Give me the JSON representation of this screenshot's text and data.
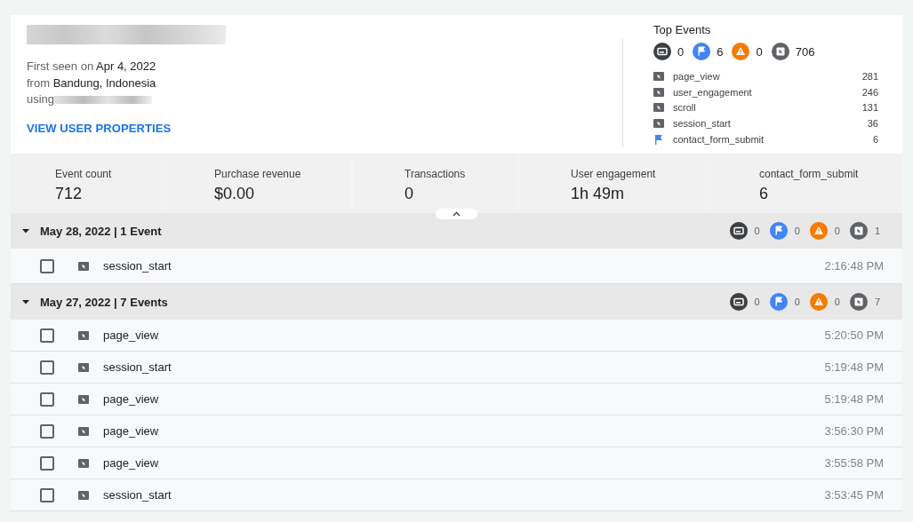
{
  "user": {
    "first_seen_label": "First seen on",
    "first_seen": "Apr 4, 2022",
    "from_label": "from",
    "location": "Bandung, Indonesia",
    "using_label": "using",
    "link": "VIEW USER PROPERTIES"
  },
  "top_events": {
    "title": "Top Events",
    "counts": [
      {
        "kind": "screen",
        "count": "0"
      },
      {
        "kind": "conversion",
        "count": "6"
      },
      {
        "kind": "error",
        "count": "0"
      },
      {
        "kind": "event",
        "count": "706"
      }
    ],
    "items": [
      {
        "kind": "event",
        "name": "page_view",
        "count": "281"
      },
      {
        "kind": "event",
        "name": "user_engagement",
        "count": "246"
      },
      {
        "kind": "event",
        "name": "scroll",
        "count": "131"
      },
      {
        "kind": "event",
        "name": "session_start",
        "count": "36"
      },
      {
        "kind": "conversion",
        "name": "contact_form_submit",
        "count": "6"
      }
    ]
  },
  "stats": [
    {
      "label": "Event count",
      "value": "712"
    },
    {
      "label": "Purchase revenue",
      "value": "$0.00"
    },
    {
      "label": "Transactions",
      "value": "0"
    },
    {
      "label": "User engagement",
      "value": "1h 49m"
    },
    {
      "label": "contact_form_submit",
      "value": "6"
    }
  ],
  "groups": [
    {
      "title": "May 28, 2022 | 1 Event",
      "expanded": true,
      "counts": [
        {
          "kind": "screen",
          "count": "0"
        },
        {
          "kind": "conversion",
          "count": "0"
        },
        {
          "kind": "error",
          "count": "0"
        },
        {
          "kind": "event",
          "count": "1"
        }
      ],
      "events": [
        {
          "kind": "event",
          "name": "session_start",
          "time": "2:16:48 PM",
          "checked": false
        }
      ]
    },
    {
      "title": "May 27, 2022 | 7 Events",
      "expanded": true,
      "counts": [
        {
          "kind": "screen",
          "count": "0"
        },
        {
          "kind": "conversion",
          "count": "0"
        },
        {
          "kind": "error",
          "count": "0"
        },
        {
          "kind": "event",
          "count": "7"
        }
      ],
      "events": [
        {
          "kind": "event",
          "name": "page_view",
          "time": "5:20:50 PM",
          "checked": false
        },
        {
          "kind": "event",
          "name": "session_start",
          "time": "5:19:48 PM",
          "checked": false
        },
        {
          "kind": "event",
          "name": "page_view",
          "time": "5:19:48 PM",
          "checked": false
        },
        {
          "kind": "event",
          "name": "page_view",
          "time": "3:56:30 PM",
          "checked": false
        },
        {
          "kind": "event",
          "name": "page_view",
          "time": "3:55:58 PM",
          "checked": false
        },
        {
          "kind": "event",
          "name": "session_start",
          "time": "3:53:45 PM",
          "checked": false
        }
      ]
    }
  ]
}
